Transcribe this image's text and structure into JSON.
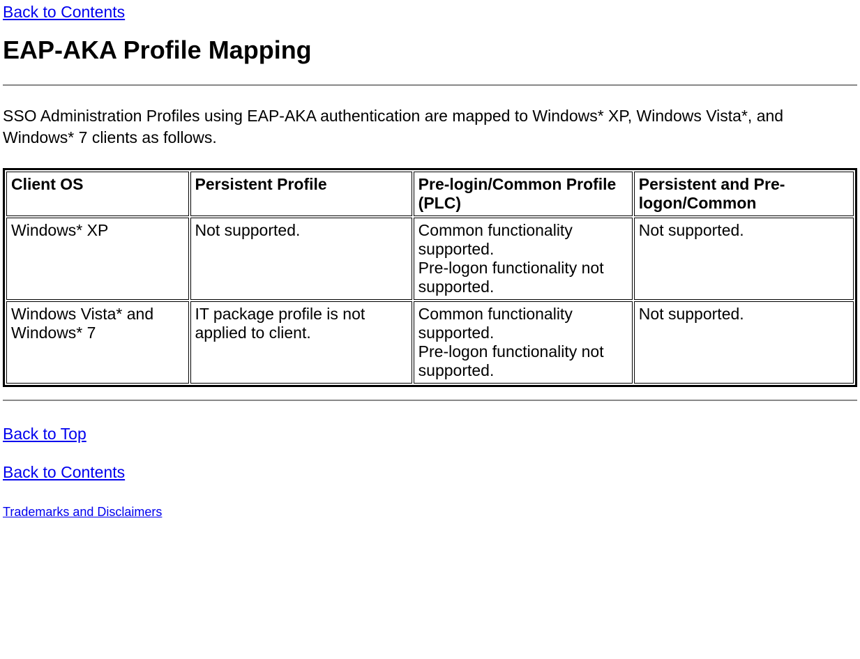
{
  "links": {
    "back_to_contents_top": "Back to Contents",
    "back_to_top": "Back to Top",
    "back_to_contents_bottom": "Back to Contents",
    "trademarks": "Trademarks and Disclaimers"
  },
  "heading": "EAP-AKA Profile Mapping",
  "intro": "SSO Administration Profiles using EAP-AKA authentication are mapped to Windows* XP, Windows Vista*, and Windows* 7 clients as follows.",
  "table": {
    "headers": {
      "col1": "Client OS",
      "col2": "Persistent Profile",
      "col3": "Pre-login/Common Profile (PLC)",
      "col4": "Persistent and Pre-logon/Common"
    },
    "rows": {
      "r0": {
        "c0": "Windows* XP",
        "c1": "Not supported.",
        "c2a": "Common functionality supported.",
        "c2b": "Pre-logon functionality not supported.",
        "c3": "Not supported."
      },
      "r1": {
        "c0": "Windows Vista* and Windows* 7",
        "c1": "IT package profile is not applied to client.",
        "c2a": "Common functionality supported.",
        "c2b": "Pre-logon functionality not supported.",
        "c3": "Not supported."
      }
    }
  }
}
